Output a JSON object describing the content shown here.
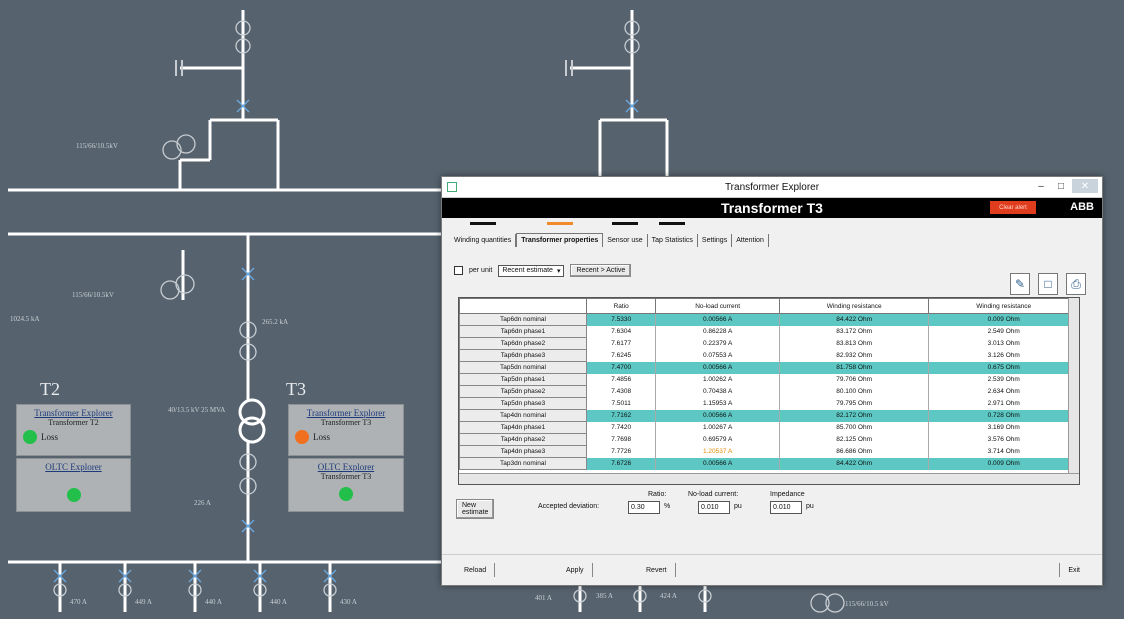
{
  "diagram": {
    "transformer_left_label": "115/66/10.5kV",
    "transformer_left2_label": "115/66/10.5kV",
    "meter_a": "265.2 kA",
    "meter_b": "245.2 kA",
    "meter_c": "1024.5 kA",
    "rating_label": "40/13.5 kV 25 MVA",
    "meter_d": "226 A",
    "meter_e": "226 A",
    "bottom_meters": [
      "470 A",
      "449 A",
      "440 A",
      "440 A",
      "430 A",
      "401 A",
      "385 A",
      "424 A"
    ],
    "bottom_right_label": "115/66/10.5 kV"
  },
  "t2": {
    "label": "T2",
    "explorer_title": "Transformer Explorer",
    "explorer_sub": "Transformer T2",
    "loss_label": "Loss",
    "loss_color": "#22c04a",
    "oltc_title": "OLTC Explorer",
    "oltc_color": "#22c04a"
  },
  "t3": {
    "label": "T3",
    "explorer_title": "Transformer Explorer",
    "explorer_sub": "Transformer T3",
    "loss_label": "Loss",
    "loss_color": "#f07020",
    "oltc_title": "OLTC Explorer",
    "oltc_sub": "Transformer T3",
    "oltc_color": "#22c04a"
  },
  "dialog": {
    "window_title": "Transformer Explorer",
    "header_title": "Transformer T3",
    "alarm_label": "Clear alert",
    "brand": "ABB",
    "tabs": [
      {
        "label": "Winding quantities",
        "indicator": "#111111"
      },
      {
        "label": "Transformer properties",
        "indicator": "#f08a2a"
      },
      {
        "label": "Sensor use",
        "indicator": "#111111"
      },
      {
        "label": "Tap Statistics",
        "indicator": "#111111"
      },
      {
        "label": "Settings",
        "indicator": ""
      },
      {
        "label": "Attention",
        "indicator": ""
      }
    ],
    "per_unit_label": "per unit",
    "estimate_select": "Recent estimate",
    "recent_button": "Recent > Active",
    "columns": [
      "",
      "Ratio",
      "No-load current",
      "Winding resistance",
      "Winding resistance"
    ],
    "rows": [
      {
        "label": "Tap6dn nominal",
        "ratio": "7.5330",
        "noload": "0.00566 A",
        "res1": "84.422 Ohm",
        "res2": "0.009 Ohm",
        "hl": true
      },
      {
        "label": "Tap6dn phase1",
        "ratio": "7.6304",
        "noload": "0.86228 A",
        "res1": "83.172 Ohm",
        "res2": "2.549 Ohm",
        "hl": false
      },
      {
        "label": "Tap6dn phase2",
        "ratio": "7.6177",
        "noload": "0.22379 A",
        "res1": "83.813 Ohm",
        "res2": "3.013 Ohm",
        "hl": false
      },
      {
        "label": "Tap6dn phase3",
        "ratio": "7.6245",
        "noload": "0.07553 A",
        "res1": "82.932 Ohm",
        "res2": "3.126 Ohm",
        "hl": false
      },
      {
        "label": "Tap5dn nominal",
        "ratio": "7.4700",
        "noload": "0.00566 A",
        "res1": "81.758 Ohm",
        "res2": "0.675 Ohm",
        "hl": true
      },
      {
        "label": "Tap5dn phase1",
        "ratio": "7.4856",
        "noload": "1.00262 A",
        "res1": "79.706 Ohm",
        "res2": "2.539 Ohm",
        "hl": false
      },
      {
        "label": "Tap5dn phase2",
        "ratio": "7.4308",
        "noload": "0.70438 A",
        "res1": "80.100 Ohm",
        "res2": "2.634 Ohm",
        "hl": false
      },
      {
        "label": "Tap5dn phase3",
        "ratio": "7.5011",
        "noload": "1.15953 A",
        "res1": "79.795 Ohm",
        "res2": "2.971 Ohm",
        "hl": false
      },
      {
        "label": "Tap4dn nominal",
        "ratio": "7.7162",
        "noload": "0.00566 A",
        "res1": "82.172 Ohm",
        "res2": "0.728 Ohm",
        "hl": true
      },
      {
        "label": "Tap4dn phase1",
        "ratio": "7.7420",
        "noload": "1.00267 A",
        "res1": "85.700 Ohm",
        "res2": "3.169 Ohm",
        "hl": false
      },
      {
        "label": "Tap4dn phase2",
        "ratio": "7.7698",
        "noload": "0.69579 A",
        "res1": "82.125 Ohm",
        "res2": "3.576 Ohm",
        "hl": false
      },
      {
        "label": "Tap4dn phase3",
        "ratio": "7.7726",
        "noload": "1.20537 A",
        "res1": "86.686 Ohm",
        "res2": "3.714 Ohm",
        "hl": false,
        "warn": true
      },
      {
        "label": "Tap3dn nominal",
        "ratio": "7.6726",
        "noload": "0.00566 A",
        "res1": "84.422 Ohm",
        "res2": "0.009 Ohm",
        "hl": true
      }
    ],
    "new_estimate_button": "New estimate",
    "accepted_deviation_label": "Accepted deviation:",
    "ratio_label": "Ratio:",
    "ratio_value": "0.30",
    "ratio_unit": "%",
    "noload_label": "No-load current:",
    "noload_value": "0.010",
    "noload_unit": "pu",
    "impedance_label": "Impedance",
    "impedance_value": "0.010",
    "impedance_unit": "pu",
    "reload_button": "Reload",
    "apply_button": "Apply",
    "revert_button": "Revert",
    "exit_button": "Exit"
  }
}
